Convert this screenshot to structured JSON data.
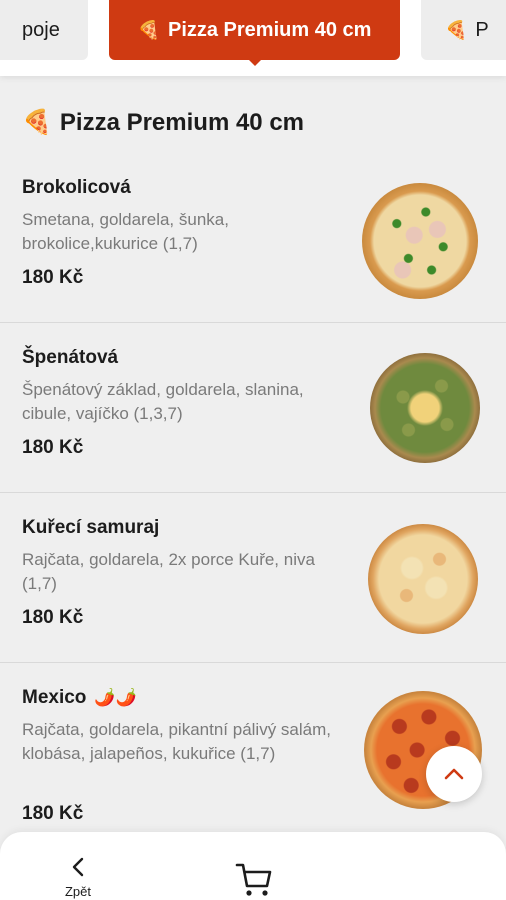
{
  "categories": {
    "prev": {
      "label": "poje"
    },
    "active": {
      "emoji": "🍕",
      "label": "Pizza Premium 40 cm"
    },
    "next": {
      "emoji": "🍕",
      "label": "P"
    }
  },
  "section": {
    "emoji": "🍕",
    "title": "Pizza Premium 40 cm"
  },
  "items": [
    {
      "name": "Brokolicová",
      "desc": "Smetana, goldarela, šunka, brokolice,kukurice (1,7)",
      "price": "180 Kč"
    },
    {
      "name": "Špenátová",
      "desc": "Špenátový základ, goldarela, slanina, cibule, vajíčko (1,3,7)",
      "price": "180 Kč"
    },
    {
      "name": "Kuřecí samuraj",
      "desc": "Rajčata, goldarela, 2x porce Kuře, niva (1,7)",
      "price": "180 Kč"
    },
    {
      "name": "Mexico",
      "name_emoji": "🌶️🌶️",
      "desc": "Rajčata, goldarela, pikantní pálivý salám, klobása, jalapeños, kukuřice (1,7)",
      "price": "180 Kč"
    }
  ],
  "bottom_nav": {
    "back_label": "Zpět"
  },
  "colors": {
    "accent": "#cf3a12"
  },
  "icons": {
    "back": "chevron-left-icon",
    "cart": "cart-icon",
    "scroll_top": "chevron-up-icon"
  }
}
